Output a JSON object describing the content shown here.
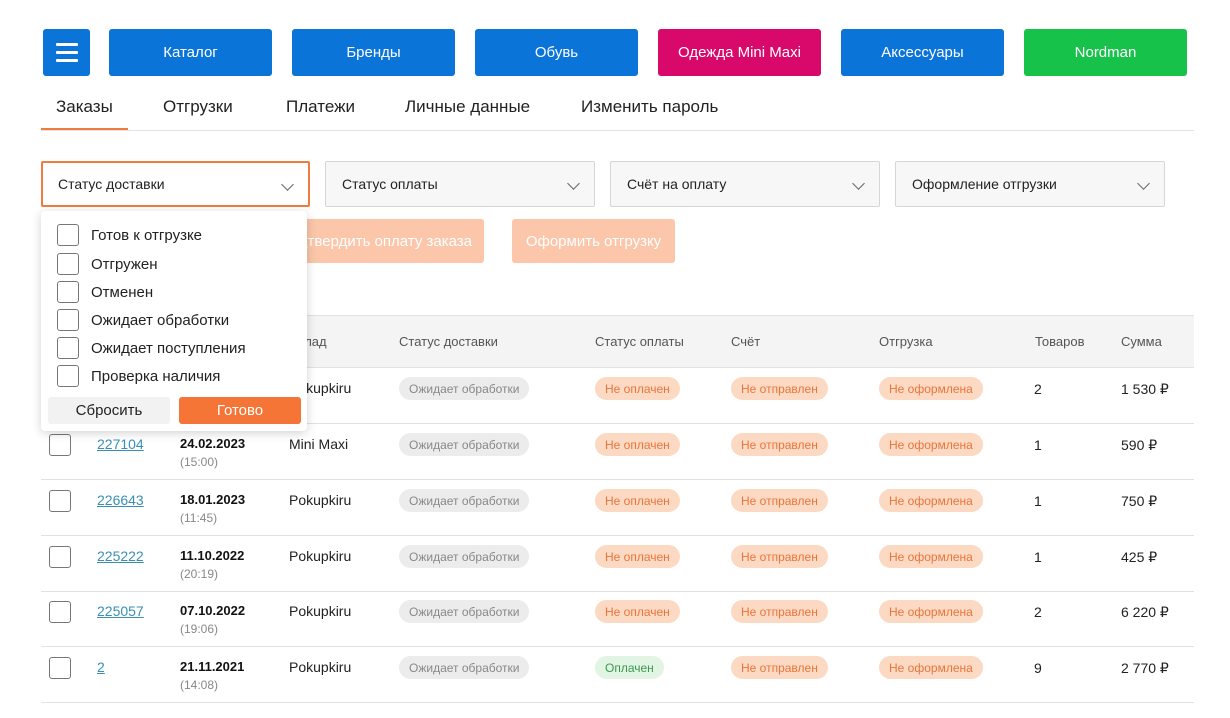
{
  "nav": {
    "menu_icon": "hamburger-icon",
    "buttons": [
      {
        "label": "Каталог",
        "color": "#0b74d8"
      },
      {
        "label": "Бренды",
        "color": "#0b74d8"
      },
      {
        "label": "Обувь",
        "color": "#0b74d8"
      },
      {
        "label": "Одежда Mini Maxi",
        "color": "#d8096b"
      },
      {
        "label": "Аксессуары",
        "color": "#0b74d8"
      },
      {
        "label": "Nordman",
        "color": "#17c24a"
      }
    ]
  },
  "tabs": [
    "Заказы",
    "Отгрузки",
    "Платежи",
    "Личные данные",
    "Изменить пароль"
  ],
  "filters": [
    "Статус доставки",
    "Статус оплаты",
    "Счёт на оплату",
    "Оформление отгрузки"
  ],
  "actions": {
    "confirm_payment": "Подтвердить оплату заказа",
    "create_shipment": "Оформить отгрузку"
  },
  "dropdown": {
    "options": [
      "Готов к отгрузке",
      "Отгружен",
      "Отменен",
      "Ожидает обработки",
      "Ожидает поступления",
      "Проверка наличия"
    ],
    "reset_label": "Сбросить",
    "done_label": "Готово"
  },
  "table": {
    "columns": [
      "Склад",
      "Статус доставки",
      "Статус оплаты",
      "Счёт",
      "Отгрузка",
      "Товаров",
      "Сумма"
    ],
    "rows": [
      {
        "order": "",
        "date": "",
        "time": "",
        "shop": "Pokupkiru",
        "delivery": "Ожидает обработки",
        "payment": "Не оплачен",
        "invoice": "Не отправлен",
        "shipment": "Не оформлена",
        "items": "2",
        "sum": "1 530 ₽"
      },
      {
        "order": "227104",
        "date": "24.02.2023",
        "time": "(15:00)",
        "shop": "Mini Maxi",
        "delivery": "Ожидает обработки",
        "payment": "Не оплачен",
        "invoice": "Не отправлен",
        "shipment": "Не оформлена",
        "items": "1",
        "sum": "590 ₽"
      },
      {
        "order": "226643",
        "date": "18.01.2023",
        "time": "(11:45)",
        "shop": "Pokupkiru",
        "delivery": "Ожидает обработки",
        "payment": "Не оплачен",
        "invoice": "Не отправлен",
        "shipment": "Не оформлена",
        "items": "1",
        "sum": "750 ₽"
      },
      {
        "order": "225222",
        "date": "11.10.2022",
        "time": "(20:19)",
        "shop": "Pokupkiru",
        "delivery": "Ожидает обработки",
        "payment": "Не оплачен",
        "invoice": "Не отправлен",
        "shipment": "Не оформлена",
        "items": "1",
        "sum": "425 ₽"
      },
      {
        "order": "225057",
        "date": "07.10.2022",
        "time": "(19:06)",
        "shop": "Pokupkiru",
        "delivery": "Ожидает обработки",
        "payment": "Не оплачен",
        "invoice": "Не отправлен",
        "shipment": "Не оформлена",
        "items": "2",
        "sum": "6 220 ₽"
      },
      {
        "order": "2",
        "date": "21.11.2021",
        "time": "(14:08)",
        "shop": "Pokupkiru",
        "delivery": "Ожидает обработки",
        "payment": "Оплачен",
        "invoice": "Не отправлен",
        "shipment": "Не оформлена",
        "items": "9",
        "sum": "2 770 ₽"
      }
    ]
  }
}
